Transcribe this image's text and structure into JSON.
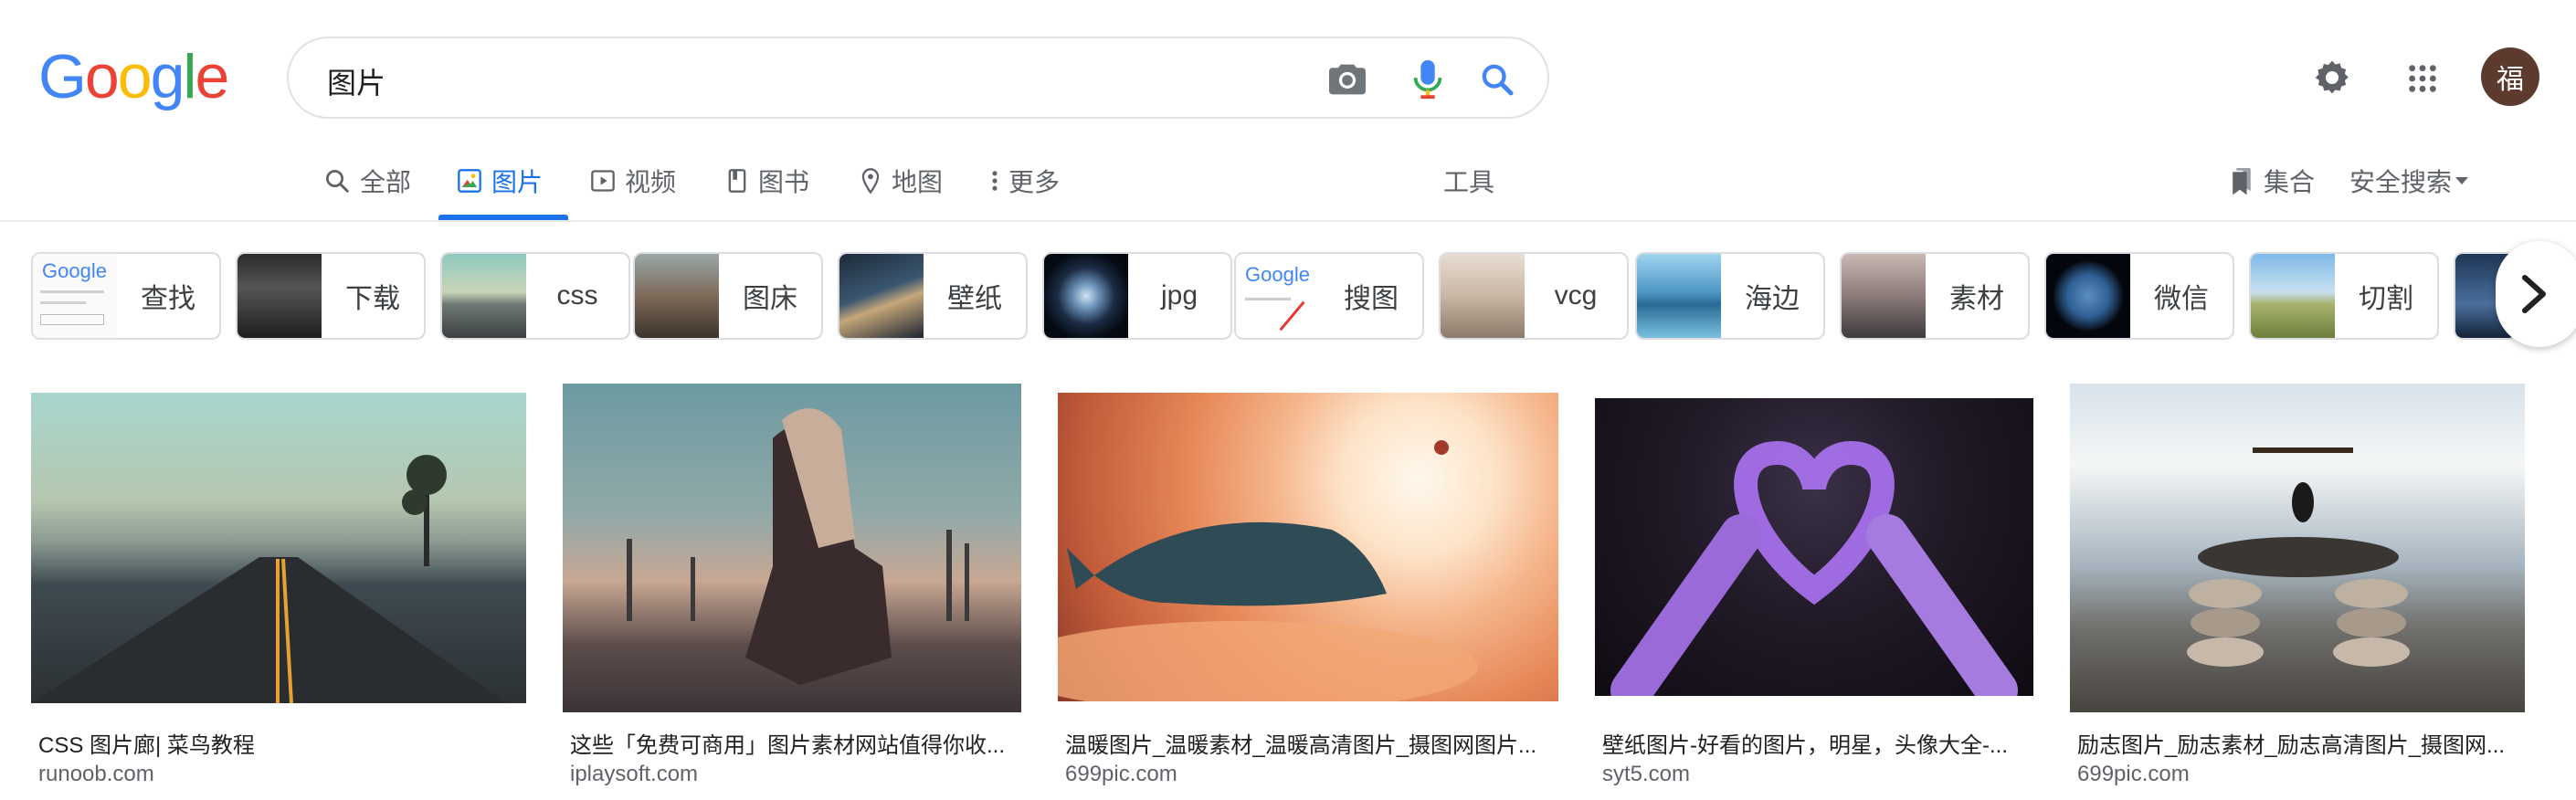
{
  "logo": {
    "letters": [
      "G",
      "o",
      "o",
      "g",
      "l",
      "e"
    ],
    "colors": [
      "#4285F4",
      "#EA4335",
      "#FBBC05",
      "#4285F4",
      "#34A853",
      "#EA4335"
    ]
  },
  "search": {
    "query": "图片"
  },
  "header": {
    "avatar_letter": "福"
  },
  "tabs": [
    {
      "label": "全部",
      "icon": "search-icon",
      "active": false
    },
    {
      "label": "图片",
      "icon": "image-icon",
      "active": true
    },
    {
      "label": "视频",
      "icon": "video-icon",
      "active": false
    },
    {
      "label": "图书",
      "icon": "book-icon",
      "active": false
    },
    {
      "label": "地图",
      "icon": "map-pin-icon",
      "active": false
    },
    {
      "label": "更多",
      "icon": "more-vert-icon",
      "active": false
    }
  ],
  "tools_label": "工具",
  "collection_label": "集合",
  "safesearch_label": "安全搜索",
  "chips": [
    {
      "label": "查找"
    },
    {
      "label": "下载"
    },
    {
      "label": "css"
    },
    {
      "label": "图床"
    },
    {
      "label": "壁纸"
    },
    {
      "label": "jpg"
    },
    {
      "label": "搜图"
    },
    {
      "label": "vcg"
    },
    {
      "label": "海边"
    },
    {
      "label": "素材"
    },
    {
      "label": "微信"
    },
    {
      "label": "切割"
    }
  ],
  "chip_thumb_text": {
    "google_word": "Google"
  },
  "results": [
    {
      "title": "CSS 图片廊| 菜鸟教程",
      "source": "runoob.com"
    },
    {
      "title": "这些「免费可商用」图片素材网站值得你收...",
      "source": "iplaysoft.com"
    },
    {
      "title": "温暖图片_温暖素材_温暖高清图片_摄图网图片...",
      "source": "699pic.com"
    },
    {
      "title": "壁纸图片-好看的图片，明星，头像大全-...",
      "source": "syt5.com"
    },
    {
      "title": "励志图片_励志素材_励志高清图片_摄图网...",
      "source": "699pic.com"
    }
  ],
  "colors": {
    "accent": "#1a73e8",
    "text": "#202124",
    "muted": "#5f6368",
    "border": "#dadce0"
  }
}
